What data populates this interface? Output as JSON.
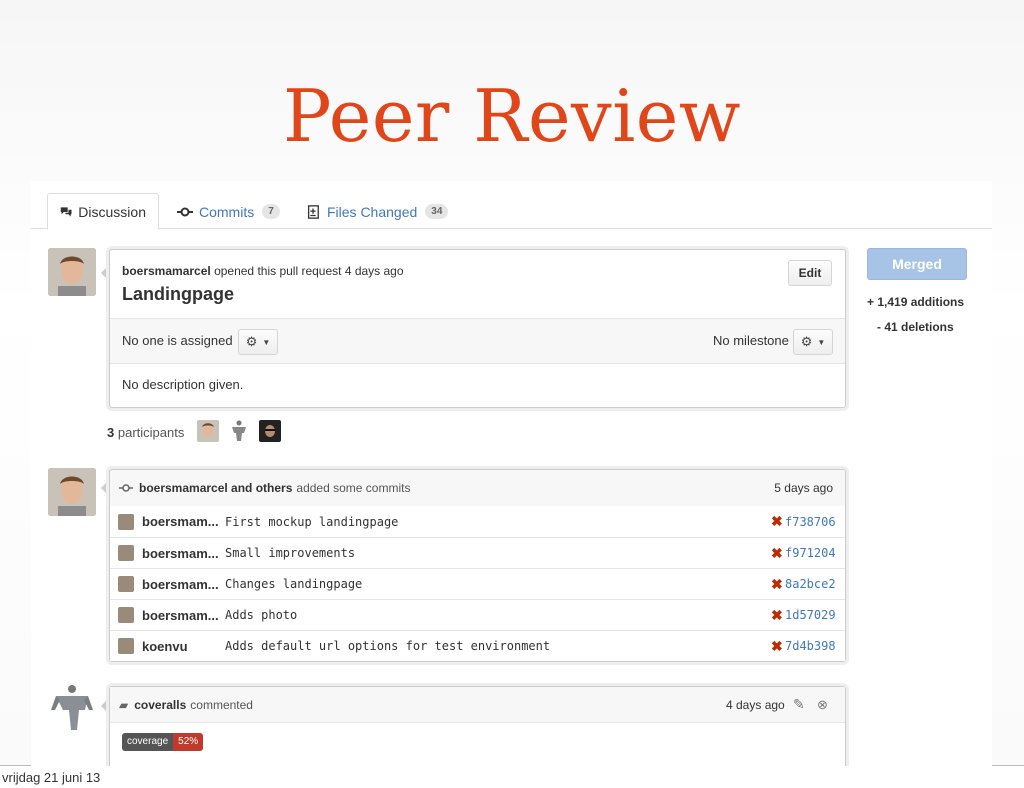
{
  "slide": {
    "title": "Peer Review",
    "footer_date": "vrijdag 21 juni 13"
  },
  "tabs": [
    {
      "label": "Discussion",
      "icon": "discussion-icon"
    },
    {
      "label": "Commits",
      "count": "7",
      "icon": "commit-icon"
    },
    {
      "label": "Files Changed",
      "count": "34",
      "icon": "diff-icon"
    }
  ],
  "pull_request": {
    "author": "boersmamarcel",
    "opened_text": "opened this pull request 4 days ago",
    "title": "Landingpage",
    "edit_label": "Edit",
    "assignee_text": "No one is assigned",
    "milestone_text": "No milestone",
    "description": "No description given."
  },
  "participants": {
    "count": "3",
    "label": "participants"
  },
  "sidebar": {
    "status": "Merged",
    "additions": "+ 1,419 additions",
    "deletions": "- 41 deletions",
    "status_color": "#a7c4e6"
  },
  "commits_block": {
    "author": "boersmamarcel and others",
    "action": "added some commits",
    "time": "5 days ago",
    "commits": [
      {
        "author": "boersmam...",
        "message": "First mockup landingpage",
        "sha": "f738706"
      },
      {
        "author": "boersmam...",
        "message": "Small improvements",
        "sha": "f971204"
      },
      {
        "author": "boersmam...",
        "message": "Changes landingpage",
        "sha": "8a2bce2"
      },
      {
        "author": "boersmam...",
        "message": "Adds photo",
        "sha": "1d57029"
      },
      {
        "author": "koenvu",
        "message": "Adds default url options for test environment",
        "sha": "7d4b398"
      }
    ]
  },
  "comment": {
    "author": "coveralls",
    "action": "commented",
    "time": "4 days ago",
    "badge_label": "coverage",
    "badge_value": "52%"
  },
  "colors": {
    "title": "#e0461a",
    "link": "#4078c0",
    "fail": "#bd2c00",
    "badge_red": "#c0392b"
  }
}
